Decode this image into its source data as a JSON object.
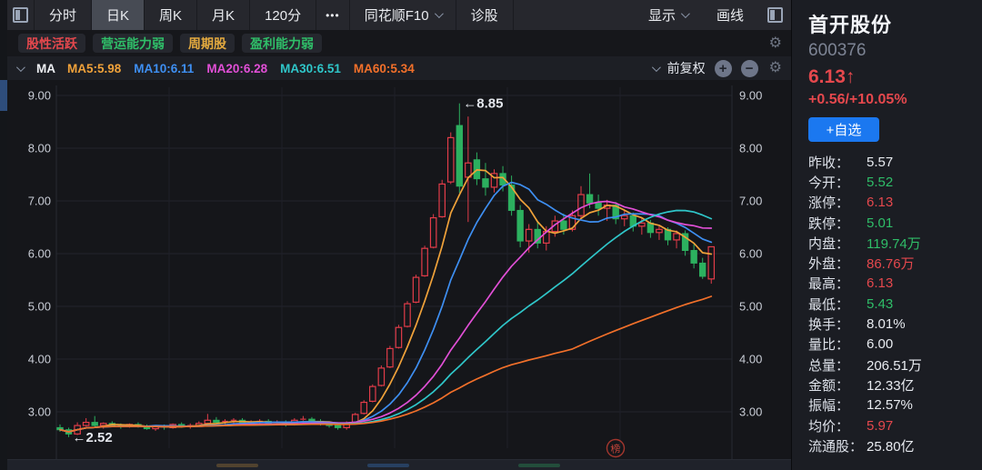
{
  "toolbar": {
    "tabs": [
      {
        "id": "minute",
        "label": "分时"
      },
      {
        "id": "daily-k",
        "label": "日K",
        "active": true
      },
      {
        "id": "weekly-k",
        "label": "周K"
      },
      {
        "id": "monthly-k",
        "label": "月K"
      },
      {
        "id": "120min",
        "label": "120分"
      },
      {
        "id": "more",
        "label": "•••",
        "narrow": true
      },
      {
        "id": "ths-f10",
        "label": "同花顺F10",
        "dropdown": true
      },
      {
        "id": "diagnose",
        "label": "诊股"
      }
    ],
    "display_label": "显示",
    "draw_label": "画线"
  },
  "tags": {
    "items": [
      {
        "id": "active-stock",
        "label": "股性活跃",
        "color": "#e5484d"
      },
      {
        "id": "weak-operation",
        "label": "营运能力弱",
        "color": "#2fbd68"
      },
      {
        "id": "cyclical-stock",
        "label": "周期股",
        "color": "#e2a93f"
      },
      {
        "id": "weak-profit",
        "label": "盈利能力弱",
        "color": "#2fbd68"
      }
    ]
  },
  "ma_bar": {
    "label": "MA",
    "items": [
      {
        "label": "MA5:5.98",
        "color": "#f0a23a"
      },
      {
        "label": "MA10:6.11",
        "color": "#3e8ff2"
      },
      {
        "label": "MA20:6.28",
        "color": "#e14fd6"
      },
      {
        "label": "MA30:6.51",
        "color": "#2fc6c9"
      },
      {
        "label": "MA60:5.34",
        "color": "#f2702a"
      }
    ],
    "adjust_label": "前复权",
    "zoom_in_icon": "+",
    "zoom_out_icon": "−"
  },
  "quote": {
    "name": "首开股份",
    "code": "600376",
    "price": "6.13↑",
    "change": "+0.56/+10.05%",
    "add_watch_label": "+自选",
    "accent_up": "#e5484d",
    "accent_down": "#2fbd68",
    "stats": [
      {
        "label": "昨收：",
        "value": "5.57",
        "color": "#e8ebf0"
      },
      {
        "label": "今开：",
        "value": "5.52",
        "color": "#2fbd68"
      },
      {
        "label": "涨停：",
        "value": "6.13",
        "color": "#e5484d"
      },
      {
        "label": "跌停：",
        "value": "5.01",
        "color": "#2fbd68"
      },
      {
        "label": "内盘：",
        "value": "119.74万",
        "color": "#2fbd68"
      },
      {
        "label": "外盘：",
        "value": "86.76万",
        "color": "#e5484d"
      },
      {
        "label": "最高：",
        "value": "6.13",
        "color": "#e5484d"
      },
      {
        "label": "最低：",
        "value": "5.43",
        "color": "#2fbd68"
      },
      {
        "label": "换手：",
        "value": "8.01%",
        "color": "#e8ebf0"
      },
      {
        "label": "量比：",
        "value": "6.00",
        "color": "#e8ebf0"
      },
      {
        "label": "总量：",
        "value": "206.51万",
        "color": "#e8ebf0"
      },
      {
        "label": "金额：",
        "value": "12.33亿",
        "color": "#e8ebf0"
      },
      {
        "label": "振幅：",
        "value": "12.57%",
        "color": "#e8ebf0"
      },
      {
        "label": "均价：",
        "value": "5.97",
        "color": "#e5484d"
      },
      {
        "label": "流通股：",
        "value": "25.80亿",
        "color": "#e8ebf0"
      }
    ]
  },
  "chart_data": {
    "type": "candlestick",
    "period": "日K",
    "y_ticks": [
      9.0,
      8.0,
      7.0,
      6.0,
      5.0,
      4.0,
      3.0
    ],
    "ylim": [
      2.3,
      9.15
    ],
    "grid": true,
    "up_color": "#e23c49",
    "down_color": "#2cb05f",
    "tick_color": "#c9cdd6",
    "annotations": [
      {
        "text": "←8.85",
        "index": 46,
        "price": 8.85
      },
      {
        "text": "←2.52",
        "index": 1,
        "price": 2.52
      }
    ],
    "stamp_text": "榜",
    "ma_series": [
      {
        "name": "MA5",
        "period": 5,
        "color": "#f0a23a"
      },
      {
        "name": "MA10",
        "period": 10,
        "color": "#3e8ff2"
      },
      {
        "name": "MA20",
        "period": 20,
        "color": "#e14fd6"
      },
      {
        "name": "MA30",
        "period": 30,
        "color": "#2fc6c9"
      },
      {
        "name": "MA60",
        "period": 60,
        "color": "#f2702a"
      }
    ],
    "candles": [
      [
        2.7,
        2.76,
        2.62,
        2.66
      ],
      [
        2.66,
        2.7,
        2.52,
        2.58
      ],
      [
        2.58,
        2.8,
        2.56,
        2.74
      ],
      [
        2.74,
        2.88,
        2.72,
        2.8
      ],
      [
        2.8,
        2.92,
        2.7,
        2.74
      ],
      [
        2.74,
        2.8,
        2.68,
        2.78
      ],
      [
        2.78,
        2.82,
        2.72,
        2.74
      ],
      [
        2.74,
        2.78,
        2.68,
        2.72
      ],
      [
        2.72,
        2.78,
        2.7,
        2.76
      ],
      [
        2.76,
        2.8,
        2.7,
        2.72
      ],
      [
        2.72,
        2.76,
        2.66,
        2.68
      ],
      [
        2.68,
        2.74,
        2.64,
        2.72
      ],
      [
        2.72,
        2.76,
        2.66,
        2.7
      ],
      [
        2.7,
        2.78,
        2.68,
        2.76
      ],
      [
        2.76,
        2.8,
        2.7,
        2.72
      ],
      [
        2.72,
        2.78,
        2.68,
        2.74
      ],
      [
        2.74,
        2.82,
        2.72,
        2.78
      ],
      [
        2.78,
        2.96,
        2.74,
        2.84
      ],
      [
        2.84,
        2.9,
        2.78,
        2.8
      ],
      [
        2.8,
        2.86,
        2.76,
        2.82
      ],
      [
        2.82,
        2.88,
        2.78,
        2.84
      ],
      [
        2.84,
        2.88,
        2.76,
        2.78
      ],
      [
        2.78,
        2.84,
        2.74,
        2.8
      ],
      [
        2.8,
        2.86,
        2.76,
        2.82
      ],
      [
        2.82,
        2.86,
        2.74,
        2.78
      ],
      [
        2.78,
        2.84,
        2.74,
        2.8
      ],
      [
        2.8,
        2.84,
        2.72,
        2.76
      ],
      [
        2.76,
        2.88,
        2.74,
        2.84
      ],
      [
        2.84,
        2.92,
        2.8,
        2.86
      ],
      [
        2.86,
        2.9,
        2.78,
        2.82
      ],
      [
        2.82,
        2.86,
        2.74,
        2.78
      ],
      [
        2.78,
        2.82,
        2.7,
        2.74
      ],
      [
        2.74,
        2.8,
        2.66,
        2.7
      ],
      [
        2.7,
        2.82,
        2.66,
        2.78
      ],
      [
        2.78,
        2.98,
        2.76,
        2.95
      ],
      [
        2.97,
        3.22,
        2.95,
        3.18
      ],
      [
        3.2,
        3.52,
        3.18,
        3.48
      ],
      [
        3.5,
        3.88,
        3.48,
        3.83
      ],
      [
        3.85,
        4.25,
        3.83,
        4.2
      ],
      [
        4.22,
        4.65,
        4.2,
        4.6
      ],
      [
        4.62,
        5.1,
        4.6,
        5.05
      ],
      [
        5.08,
        5.6,
        5.06,
        5.55
      ],
      [
        5.58,
        6.15,
        5.56,
        6.1
      ],
      [
        6.12,
        6.75,
        6.1,
        6.68
      ],
      [
        6.7,
        7.4,
        6.68,
        7.32
      ],
      [
        7.36,
        8.3,
        7.32,
        8.2
      ],
      [
        8.43,
        8.85,
        7.15,
        7.28
      ],
      [
        7.45,
        8.6,
        6.6,
        7.72
      ],
      [
        7.78,
        7.92,
        7.3,
        7.42
      ],
      [
        7.42,
        7.72,
        7.1,
        7.26
      ],
      [
        7.26,
        7.6,
        7.16,
        7.52
      ],
      [
        7.52,
        7.66,
        7.18,
        7.3
      ],
      [
        7.3,
        7.48,
        6.72,
        6.82
      ],
      [
        6.82,
        6.92,
        6.12,
        6.24
      ],
      [
        6.24,
        6.56,
        6.02,
        6.46
      ],
      [
        6.46,
        6.62,
        6.1,
        6.2
      ],
      [
        6.2,
        6.52,
        6.06,
        6.42
      ],
      [
        6.42,
        6.72,
        6.32,
        6.62
      ],
      [
        6.62,
        6.76,
        6.36,
        6.46
      ],
      [
        6.46,
        6.82,
        6.42,
        6.72
      ],
      [
        6.72,
        7.28,
        6.66,
        7.12
      ],
      [
        7.12,
        7.52,
        6.86,
        6.96
      ],
      [
        6.96,
        7.12,
        6.72,
        6.86
      ],
      [
        6.86,
        7.02,
        6.62,
        6.92
      ],
      [
        6.92,
        6.98,
        6.56,
        6.66
      ],
      [
        6.66,
        6.82,
        6.52,
        6.72
      ],
      [
        6.72,
        6.78,
        6.42,
        6.52
      ],
      [
        6.52,
        6.68,
        6.36,
        6.58
      ],
      [
        6.58,
        6.64,
        6.3,
        6.4
      ],
      [
        6.4,
        6.52,
        6.26,
        6.46
      ],
      [
        6.46,
        6.5,
        6.16,
        6.26
      ],
      [
        6.26,
        6.44,
        6.1,
        6.38
      ],
      [
        6.38,
        6.44,
        5.96,
        6.06
      ],
      [
        6.06,
        6.18,
        5.72,
        5.82
      ],
      [
        5.82,
        5.92,
        5.52,
        5.57
      ],
      [
        5.52,
        6.13,
        5.43,
        6.13
      ]
    ]
  }
}
